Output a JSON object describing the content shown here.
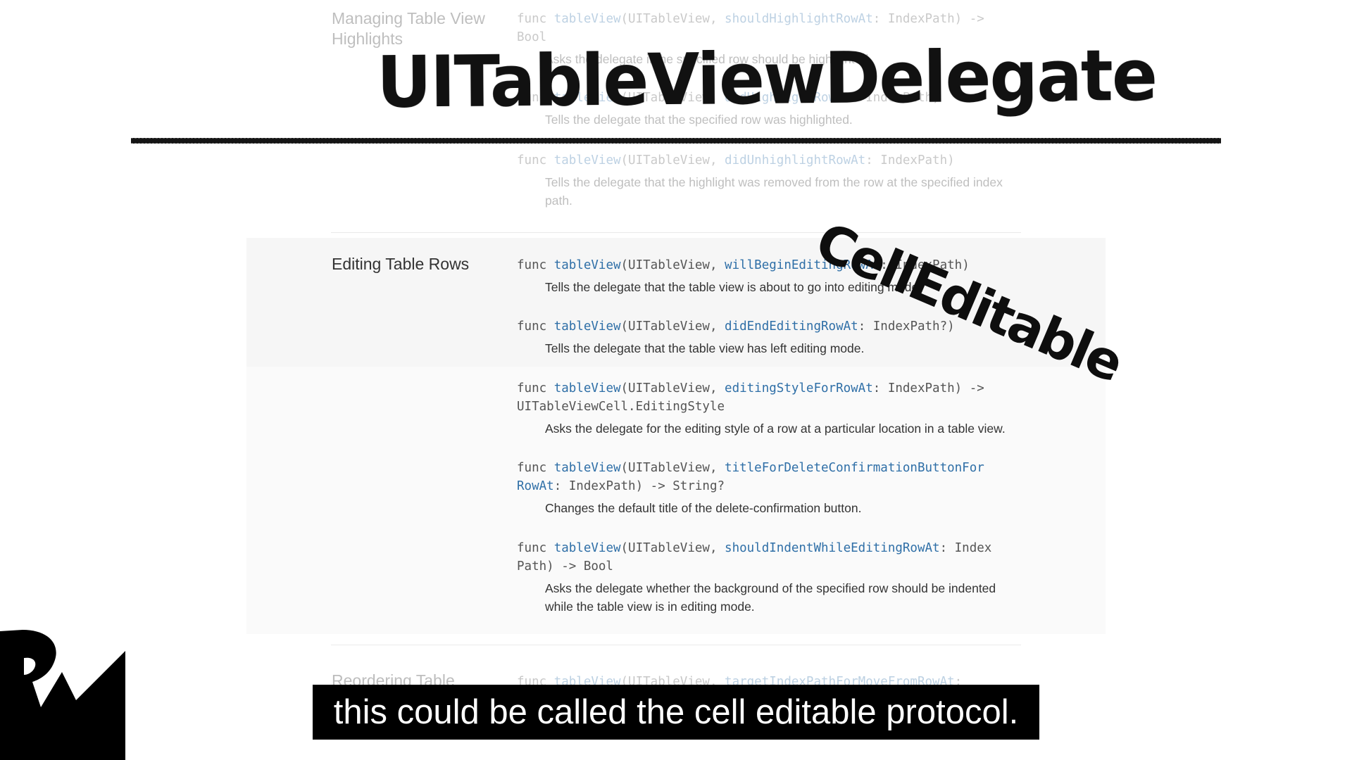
{
  "sections": {
    "highlights": {
      "title": "Managing Table View Highlights",
      "items": [
        {
          "sig_pre": "func ",
          "sig_method": "tableView",
          "sig_mid": "(UITableView, ",
          "sig_label": "shouldHighlightRowAt",
          "sig_post": ": IndexPath) ->\nBool",
          "desc": "Asks the delegate if the specified row should be highlighted."
        },
        {
          "sig_pre": "func ",
          "sig_method": "tableView",
          "sig_mid": "(UITableView, ",
          "sig_label": "didHighlightRowAt",
          "sig_post": ": IndexPath)",
          "desc": "Tells the delegate that the specified row was highlighted."
        },
        {
          "sig_pre": "func ",
          "sig_method": "tableView",
          "sig_mid": "(UITableView, ",
          "sig_label": "didUnhighlightRowAt",
          "sig_post": ": IndexPath)",
          "desc": "Tells the delegate that the highlight was removed from the row at the specified index path."
        }
      ]
    },
    "editing": {
      "title": "Editing Table Rows",
      "items": [
        {
          "sig_pre": "func ",
          "sig_method": "tableView",
          "sig_mid": "(UITableView, ",
          "sig_label": "willBeginEditingRowAt",
          "sig_post": ": IndexPath)",
          "desc": "Tells the delegate that the table view is about to go into editing mode."
        },
        {
          "sig_pre": "func ",
          "sig_method": "tableView",
          "sig_mid": "(UITableView, ",
          "sig_label": "didEndEditingRowAt",
          "sig_post": ": IndexPath?)",
          "desc": "Tells the delegate that the table view has left editing mode."
        },
        {
          "sig_pre": "func ",
          "sig_method": "tableView",
          "sig_mid": "(UITableView, ",
          "sig_label": "editingStyleForRowAt",
          "sig_post": ": IndexPath) ->\nUITableViewCell.EditingStyle",
          "desc": "Asks the delegate for the editing style of a row at a particular location in a table view."
        },
        {
          "sig_pre": "func ",
          "sig_method": "tableView",
          "sig_mid": "(UITableView, ",
          "sig_label": "titleForDeleteConfirmationButtonFor\nRowAt",
          "sig_post": ": IndexPath) -> String?",
          "desc": "Changes the default title of the delete-confirmation button."
        },
        {
          "sig_pre": "func ",
          "sig_method": "tableView",
          "sig_mid": "(UITableView, ",
          "sig_label": "shouldIndentWhileEditingRowAt",
          "sig_post": ": Index\nPath) -> Bool",
          "desc": "Asks the delegate whether the background of the specified row should be indented while the table view is in editing mode."
        }
      ]
    },
    "reordering": {
      "title": "Reordering Table",
      "items": [
        {
          "sig_pre": "func ",
          "sig_method": "tableView",
          "sig_mid": "(UITableView, ",
          "sig_label": "targetIndexPathForMoveFromRowAt",
          "sig_post": ":"
        }
      ]
    }
  },
  "overlay": {
    "heading": "UITableViewDelegate",
    "stamp": "CellEditable",
    "subtitle": "this could be called the cell editable protocol."
  },
  "logo": {
    "name": "rw-logo"
  }
}
